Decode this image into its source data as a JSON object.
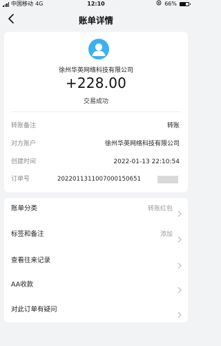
{
  "status_bar": {
    "carrier": "中国移动",
    "network": "4G",
    "time": "12:10",
    "battery": "66%",
    "battery_level": 0.66
  },
  "nav": {
    "title": "账单详情"
  },
  "summary": {
    "merchant": "徐州华英网络科技有限公司",
    "amount": "+228.00",
    "status": "交易成功"
  },
  "details": [
    {
      "label": "转账备注",
      "value": "转账"
    },
    {
      "label": "对方账户",
      "value": "徐州华英网络科技有限公司"
    },
    {
      "label": "创建时间",
      "value": "2022-01-13 22:10:54"
    },
    {
      "label": "订单号",
      "value": "2022011311007000150651"
    }
  ],
  "menu": [
    {
      "label": "账单分类",
      "value": "转账红包"
    },
    {
      "label": "标签和备注",
      "value": "添加"
    },
    {
      "label": "查看往来记录",
      "value": ""
    },
    {
      "label": "AA收款",
      "value": ""
    },
    {
      "label": "对此订单有疑问",
      "value": ""
    }
  ],
  "colors": {
    "background": "#f2f3f5",
    "avatar": "#3bb0f3",
    "label": "#8a8a8a"
  }
}
